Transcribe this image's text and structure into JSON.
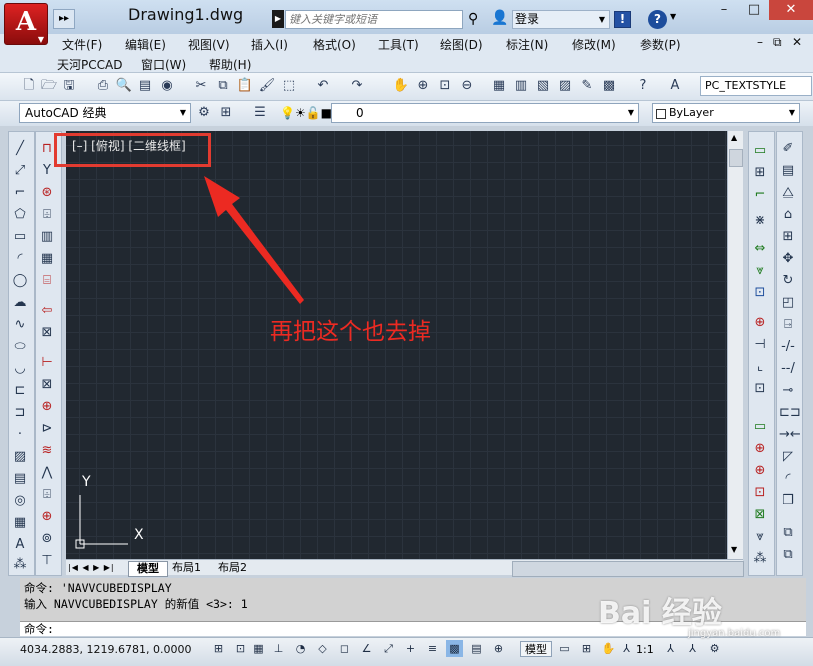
{
  "titlebar": {
    "app_logo": "A",
    "doc_title": "Drawing1.dwg",
    "search_placeholder": "键入关键字或短语",
    "login_label": "登录",
    "exchange_label": "!",
    "help_label": "?",
    "window_controls": [
      "–",
      "□",
      "✕"
    ]
  },
  "menu": {
    "row1": [
      "文件(F)",
      "编辑(E)",
      "视图(V)",
      "插入(I)",
      "格式(O)",
      "工具(T)",
      "绘图(D)",
      "标注(N)",
      "修改(M)",
      "参数(P)"
    ],
    "row2": [
      "天河PCCAD",
      "窗口(W)",
      "帮助(H)"
    ],
    "doc_controls": [
      "–",
      "⧉",
      "✕"
    ]
  },
  "toolbar": {
    "text_style": "PC_TEXTSTYLE",
    "workspace": "AutoCAD 经典",
    "layer": "0",
    "color": "ByLayer"
  },
  "viewport": {
    "label": "[–] [俯视] [二维线框]",
    "ucs_x": "X",
    "ucs_y": "Y"
  },
  "annotation": {
    "text": "再把这个也去掉",
    "color": "#ec2a22"
  },
  "layout_tabs": [
    "模型",
    "布局1",
    "布局2"
  ],
  "command": {
    "line1": "命令: 'NAVVCUBEDISPLAY",
    "line2": "输入 NAVVCUBEDISPLAY 的新值 <3>: 1",
    "prompt": "命令:"
  },
  "status": {
    "coordinates": "4034.2883, 1219.6781, 0.0000",
    "model_label": "模型",
    "scale": "1:1"
  },
  "watermark": {
    "brand": "Bai 经验",
    "url": "jingyan.baidu.com"
  },
  "colors": {
    "canvas_bg": "#212830",
    "highlight_box": "#e23b30",
    "accent_blue": "#1d4d9c"
  }
}
